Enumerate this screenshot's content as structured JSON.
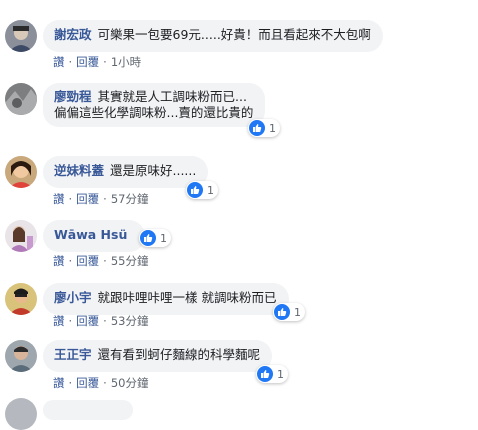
{
  "comments": [
    {
      "name": "謝宏政",
      "text": "可樂果一包要69元.....好貴！而且看起來不大包啊",
      "like_label": "讚",
      "reply_label": "回覆",
      "time": "1小時",
      "reaction_count": ""
    },
    {
      "name": "廖勁程",
      "text": "其實就是人工調味粉而已...",
      "text2": "偏偏這些化學調味粉...賣的還比貴的",
      "like_label": "讚",
      "reply_label": "回覆",
      "time": "",
      "reaction_count": "1"
    },
    {
      "name": "逆妹料蓋",
      "text": "還是原味好......",
      "like_label": "讚",
      "reply_label": "回覆",
      "time": "57分鐘",
      "reaction_count": "1"
    },
    {
      "name": "Wāwa Hsü",
      "text": "",
      "like_label": "讚",
      "reply_label": "回覆",
      "time": "55分鐘",
      "reaction_count": "1"
    },
    {
      "name": "廖小宇",
      "text": "就跟咔哩咔哩一樣 就調味粉而已",
      "like_label": "讚",
      "reply_label": "回覆",
      "time": "53分鐘",
      "reaction_count": "1"
    },
    {
      "name": "王正宇",
      "text": "還有看到蚵仔麵線的科學麵呢",
      "like_label": "讚",
      "reply_label": "回覆",
      "time": "50分鐘",
      "reaction_count": "1"
    }
  ],
  "colors": {
    "name": "#385898",
    "bubble": "#f2f3f5",
    "like": "#2078f4",
    "meta": "#606770"
  },
  "icons": [
    "thumbs-up-icon"
  ]
}
